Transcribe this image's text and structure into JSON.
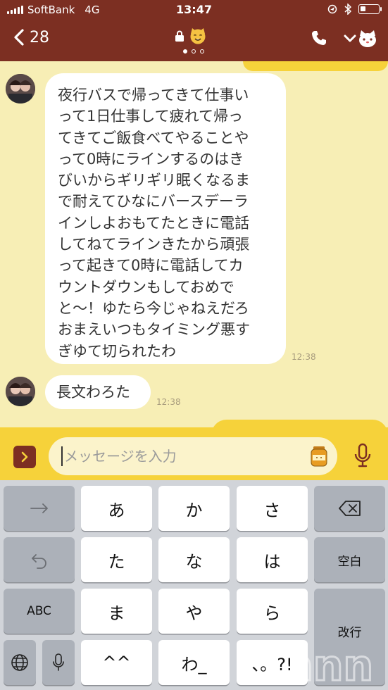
{
  "status_bar": {
    "carrier": "SoftBank",
    "network": "4G",
    "time": "13:47"
  },
  "header": {
    "back_count": "28",
    "page_indicator": {
      "count": 3,
      "active": 0
    }
  },
  "messages": [
    {
      "direction": "incoming",
      "lines": [
        "夜行バスで帰ってきて仕事い",
        "って1日仕事して疲れて帰っ",
        "てきてご飯食べてやることや",
        "って0時にラインするのはき",
        "びいからギリギリ眠くなるま",
        "で耐えてひなにバースデーラ",
        "インしよおもてたときに電話",
        "してねてラインきたから頑張",
        "って起きて0時に電話してカ",
        "ウントダウンもしておめで",
        "と〜！ゆたら今じゃねえだろ",
        "おまえいつもタイミング悪す",
        "ぎゆて切られたわ"
      ],
      "time": "12:38"
    },
    {
      "direction": "incoming",
      "lines": [
        "長文わろた"
      ],
      "time": "12:38"
    }
  ],
  "composer": {
    "placeholder": "メッセージを入力"
  },
  "keyboard": {
    "rows": [
      [
        "→",
        "あ",
        "か",
        "さ",
        "⌫"
      ],
      [
        "↺",
        "た",
        "な",
        "は",
        "空白"
      ],
      [
        "ABC",
        "ま",
        "や",
        "ら",
        "改行"
      ],
      [
        "🌐",
        "🎤",
        "^^",
        "わ_",
        "、。?!"
      ]
    ],
    "keys": {
      "a": "あ",
      "ka": "か",
      "sa": "さ",
      "ta": "た",
      "na": "な",
      "ha": "は",
      "ma": "ま",
      "ya": "や",
      "ra": "ら",
      "emoji": "^^",
      "wa": "わ_",
      "punct": "、。?!",
      "abc": "ABC",
      "space": "空白",
      "return": "改行"
    }
  },
  "colors": {
    "header_bg": "#7c2f22",
    "chat_bg": "#f7eeb5",
    "accent_yellow": "#f6d23a",
    "keyboard_bg": "#d1d4d9"
  },
  "icons": [
    "signal-icon",
    "location-icon",
    "bluetooth-icon",
    "battery-icon",
    "chevron-left-icon",
    "lock-icon",
    "cat-face-icon",
    "phone-icon",
    "chevron-down-icon",
    "cat-menu-icon",
    "expand-icon",
    "sticker-icon",
    "microphone-icon",
    "arrow-right-icon",
    "backspace-icon",
    "undo-icon",
    "globe-icon",
    "keyboard-mic-icon"
  ]
}
